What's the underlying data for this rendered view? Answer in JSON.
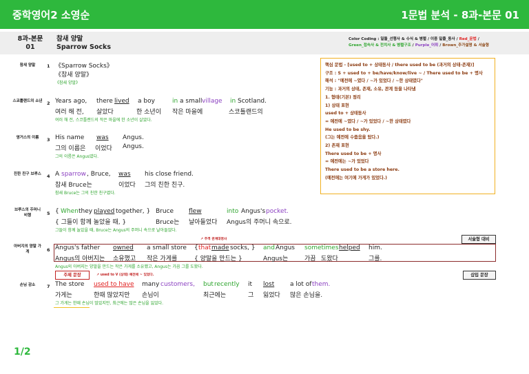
{
  "header": {
    "title_left": "중학영어2 소영순",
    "title_right": "1문법 분석 - 8과-본문 01"
  },
  "subheader": {
    "code_line1": "8과-본문",
    "code_line2": "01",
    "title_ko": "참새 양말",
    "title_en": "Sparrow Socks",
    "color_coding_line1_a": "Color Coding : 일돌_선행사 & 수식 & 병렬 / 이중 밑줄_동사 / ",
    "color_coding_line1_b": "Red_문법",
    "color_coding_line1_c": " /",
    "color_coding_line2_a": "Green_접속사 & 전치사 & 병렬구조",
    "color_coding_line2_b": " / ",
    "color_coding_line2_c": "Purple_어휘",
    "color_coding_line2_d": " / ",
    "color_coding_line2_e": "Brown_추가설명 & 서술형"
  },
  "rows": [
    {
      "label": "참새 양말",
      "num": "1",
      "en1": "《Sparrow Socks》",
      "ko1": "《참새 양말》",
      "tr": "《참새 양말》"
    },
    {
      "label": "스코틀랜드의 소년",
      "num": "2",
      "en": [
        "Years ago,",
        "there",
        "lived",
        "a boy",
        "in",
        "a small",
        "village",
        "in",
        "Scotland."
      ],
      "ko": [
        "여러 해 전,",
        "살았다",
        "한 소년이",
        "작은 마을에",
        "스코틀랜드의"
      ],
      "tr": "여러 해 전, 스코틀랜드의 작은 마을에 한 소년이 살았다."
    },
    {
      "label": "영거스의 이름",
      "num": "3",
      "en": [
        "His name",
        "was",
        "Angus."
      ],
      "ko": [
        "그의 이름은",
        "이었다",
        "Angus."
      ],
      "tr": "그의 이름은 Angus였다."
    },
    {
      "label": "친한 친구 브루스",
      "num": "4",
      "en": [
        "A",
        "sparrow",
        ", Bruce,",
        "was",
        "his close friend."
      ],
      "ko": [
        "참새 Bruce는",
        "이었다",
        "그의 친한 친구."
      ],
      "tr": "참새 Bruce는 그의 친한 친구였다."
    },
    {
      "label": "브루스의 주머니 비행",
      "num": "5",
      "en": [
        "{",
        "When",
        "they",
        "played",
        "together, }",
        "Bruce",
        "flew",
        "into",
        "Angus's",
        "pocket."
      ],
      "ko": [
        "{ 그들이 함께 놀았을 때, }",
        "Bruce는",
        "날아들었다",
        "Angus의 주머니 속으로."
      ],
      "tr": "그들이 함께 놀았을 때, Bruce는 Angus의 주머니 속으로 날아들었다."
    },
    {
      "label": "아버지의 양말 가게",
      "num": "6",
      "en": [
        "Angus's father",
        "owned",
        "a small store",
        "{",
        "that",
        "made",
        "socks, }",
        "and",
        "Angus",
        "sometimes",
        "helped",
        "him."
      ],
      "ko": [
        "Angus의 아버지는",
        "소유했고",
        "작은 가게를",
        "{ 양말을 만드는 }",
        "Angus는",
        "가끔",
        "도왔다",
        "그를."
      ],
      "tr": "Angus의 아버지는 양말을 만드는 작은 가게를 소유했고, Angus는 가끔 그를 도왔다."
    },
    {
      "label": "손님 감소",
      "num": "7",
      "en": [
        "The store",
        "used to have",
        "many",
        "customers,",
        "but",
        "recently",
        "it",
        "lost",
        "a lot of",
        "them."
      ],
      "ko": [
        "가게는",
        "한때 많았지만",
        "손님이",
        "최근에는",
        "그",
        "잃었다",
        "많은 손님을."
      ],
      "tr": "그 가게는 한때 손님이 많았지만, 최근에는 많은 손님을 잃었다."
    }
  ],
  "tags": {
    "essay": "서술형 대비",
    "insert": "삽입 문장",
    "subject": "주제 문장"
  },
  "annotations": {
    "relative": "주격 관계대명사",
    "used_to": "used to V (상태) 예전에 ~ 있었다."
  },
  "grammar_box": [
    "핵심 문법 - [used to + 상태동사 / there used to be (과거의 상태-존재)]",
    "구조 : S + used to + be/have/know/live ~ / There used to be + 명사",
    "해석 : \"예전에 ~였다 / ~가 있었다 / ~한 상태였다\"",
    "기능 : 과거의 상태, 존재, 소유, 관계 등을 나타냄",
    "1. 형태(기본) 정리",
    "1) 상태 표현",
    "used to + 상태동사",
    "= 예전에 ~였다 / ~가 있었다 / ~한 상태였다",
    "He used to be shy.",
    "(그는 예전에 수줍음을 탔다.)",
    "2) 존재 표현",
    "There used to be + 명사",
    "= 예전에는 ~가 있었다",
    "There used to be a store here.",
    "(예전에는 여기에 가게가 있었다.)"
  ],
  "page": "1/2"
}
